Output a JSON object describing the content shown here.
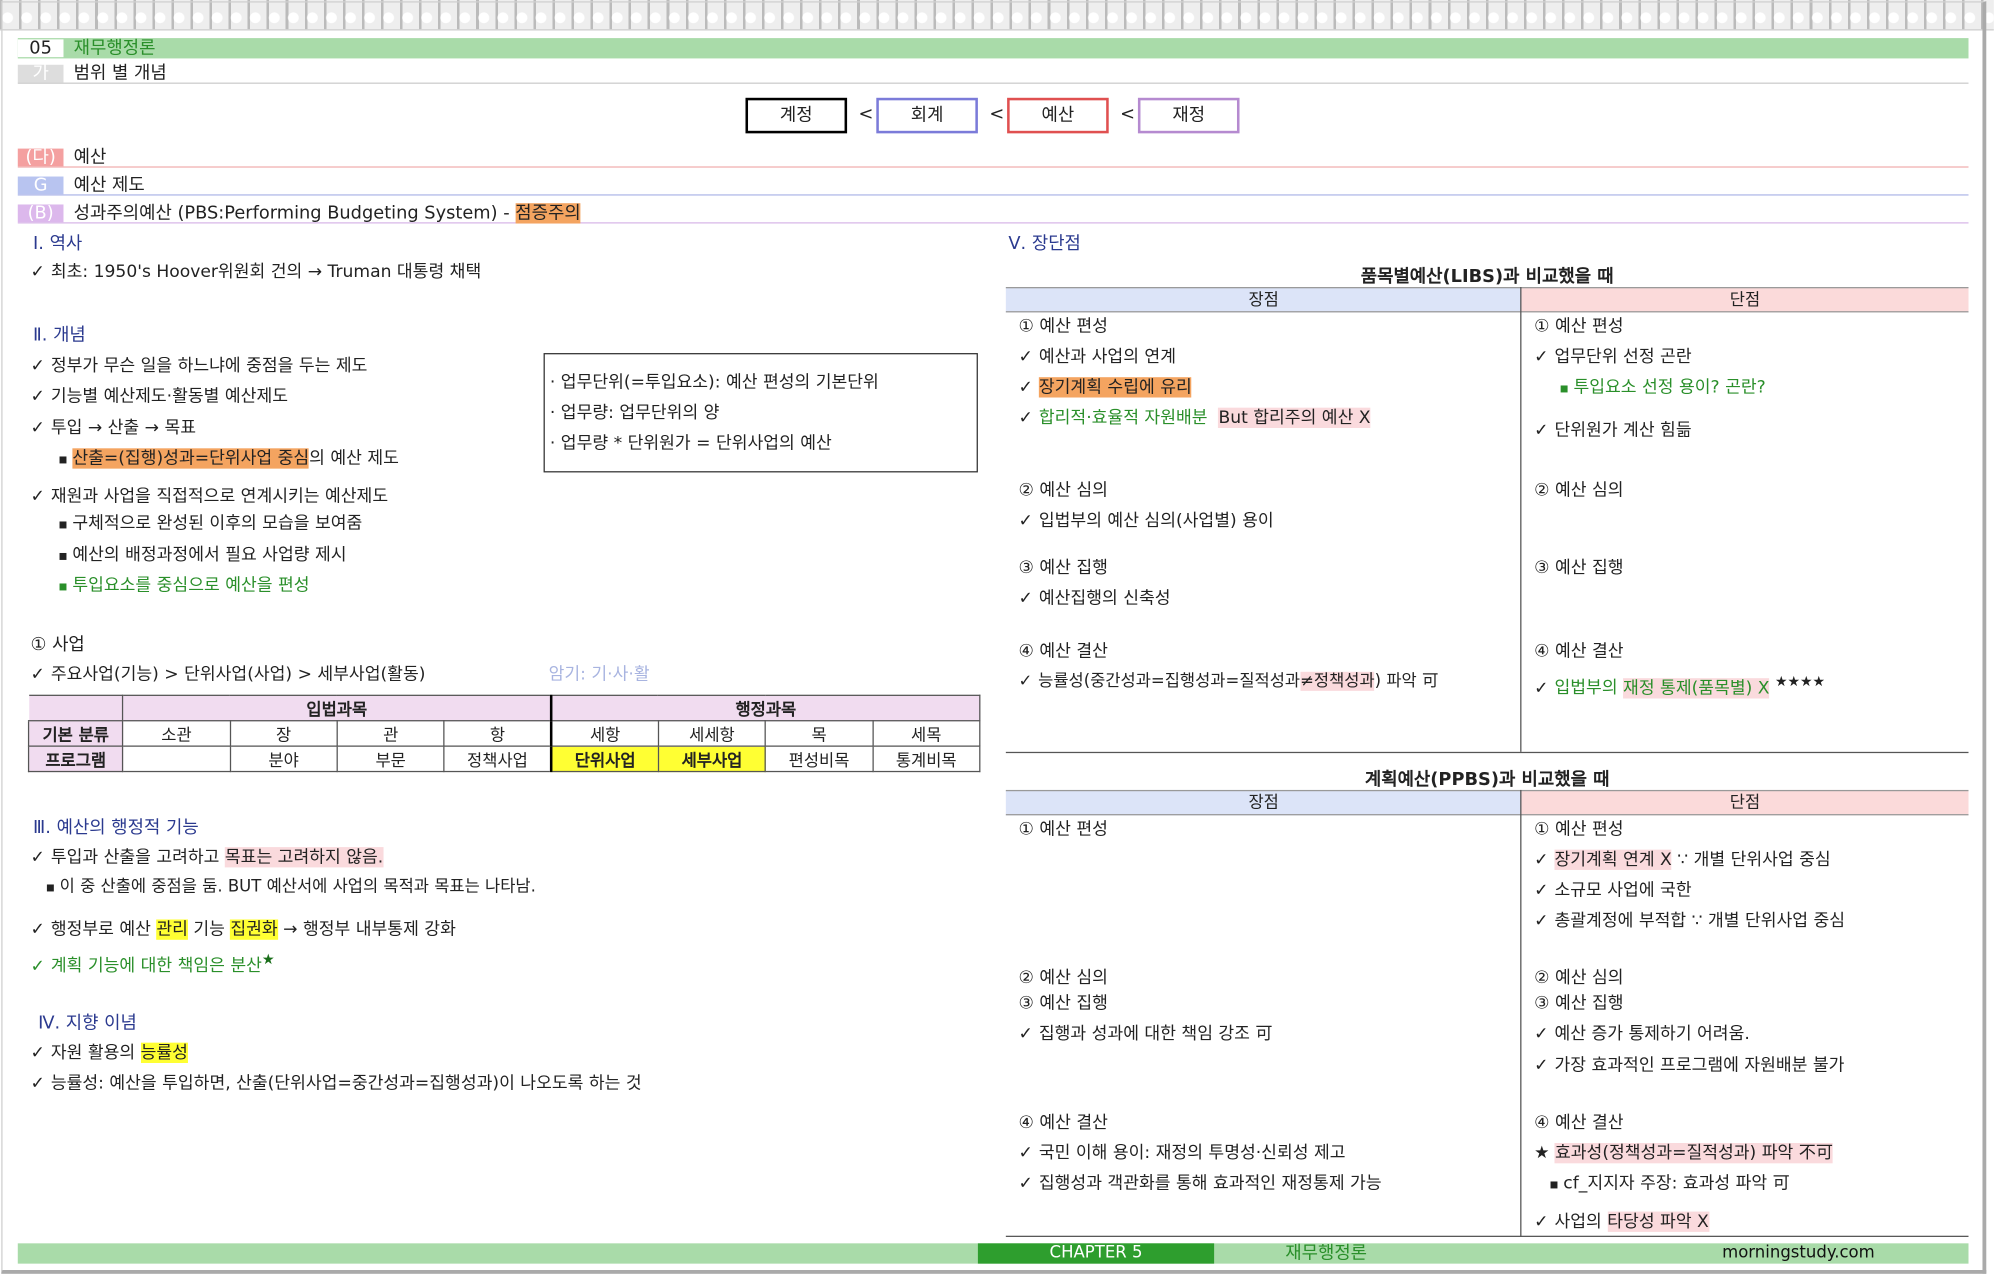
{
  "chapter": {
    "num": "05",
    "title": "재무행정론"
  },
  "sub": {
    "num": "가",
    "title": "범위 별 개념"
  },
  "scope_boxes": [
    "계정",
    "회계",
    "예산",
    "재정"
  ],
  "scope_sep": "<",
  "section_da": {
    "num": "(다)",
    "title": "예산"
  },
  "section_g": {
    "num": "G",
    "title": "예산 제도"
  },
  "section_b": {
    "num": "(B)",
    "title": "성과주의예산 (PBS:Performing Budgeting System) - ",
    "highlight": "점증주의"
  },
  "left": {
    "history_title": "Ⅰ. 역사",
    "history_line": "최초: 1950's Hoover위원회 건의 → Truman 대통령 채택",
    "concept_title": "Ⅱ. 개념",
    "concept_lines": [
      "정부가 무슨 일을 하느냐에 중점을 두는 제도",
      "기능별 예산제도·활동별 예산제도",
      "투입 → 산출 → 목표"
    ],
    "concept_bullet_hl": "산출=(집행)성과=단위사업 중심",
    "concept_bullet_rest": "의 예산 제도",
    "concept_line4": "재원과 사업을 직접적으로 연계시키는 예산제도",
    "concept_bullets": [
      "구체적으로 완성된 이후의 모습을 보여줌",
      "예산의 배정과정에서 필요 사업량 제시"
    ],
    "concept_bullet_green": "투입요소를 중심으로 예산을 편성",
    "box_lines": [
      "· 업무단위(=투입요소): 예산 편성의 기본단위",
      "· 업무량: 업무단위의 양",
      "· 업무량 * 단위원가 = 단위사업의 예산"
    ],
    "business_title": "① 사업",
    "business_line": "주요사업(기능) > 단위사업(사업) > 세부사업(활동)",
    "business_memo": "암기: 기·사·활",
    "table": {
      "group1": "입법과목",
      "group2": "행정과목",
      "row1_label": "기본 분류",
      "row1": [
        "소관",
        "장",
        "관",
        "항",
        "세항",
        "세세항",
        "목",
        "세목"
      ],
      "row2_label": "프로그램",
      "row2": [
        "",
        "분야",
        "부문",
        "정책사업",
        "단위사업",
        "세부사업",
        "편성비목",
        "통계비목"
      ]
    },
    "admin_title": "Ⅲ. 예산의 행정적 기능",
    "admin_line1a": "투입과 산출을 고려하고 ",
    "admin_line1hl": "목표는 고려하지 않음.",
    "admin_bullet": "이 중 산출에 중점을 둠. BUT 예산서에 사업의 목적과 목표는 나타남.",
    "admin_line2a": "행정부로 예산 ",
    "admin_line2hl1": "관리",
    "admin_line2b": " 기능 ",
    "admin_line2hl2": "집권화",
    "admin_line2c": " → 행정부 내부통제 강화",
    "admin_line3": "계획 기능에 대한 책임은 분산",
    "star": "★",
    "ideal_title": "Ⅳ. 지향 이념",
    "ideal_line1a": "자원 활용의 ",
    "ideal_line1hl": "능률성",
    "ideal_line2": "능률성: 예산을 투입하면, 산출(단위사업=중간성과=집행성과)이 나오도록 하는 것"
  },
  "right": {
    "title": "Ⅴ. 장단점",
    "compare1_title": "품목별예산(LIBS)과 비교했을 때",
    "compare2_title": "계획예산(PPBS)과 비교했을 때",
    "pro": "장점",
    "con": "단점",
    "c1_pro": {
      "h1": "① 예산 편성",
      "l1": "예산과 사업의 연계",
      "l2": "장기계획 수립에 유리",
      "l3a": "합리적·효율적 자원배분",
      "l3b": "But 합리주의 예산 X",
      "h2": "② 예산 심의",
      "l4": "입법부의 예산 심의(사업별) 용이",
      "h3": "③ 예산 집행",
      "l5": "예산집행의 신축성",
      "h4": "④ 예산 결산",
      "l6a": "능률성(중간성과=집행성과=질적성과",
      "l6b": "≠정책성과",
      "l6c": ") 파악 可"
    },
    "c1_con": {
      "h1": "① 예산 편성",
      "l1": "업무단위 선정 곤란",
      "l2": "투입요소 선정 용이? 곤란?",
      "l3": "단위원가 계산 힘듦",
      "h2": "② 예산 심의",
      "h3": "③ 예산 집행",
      "h4": "④ 예산 결산",
      "l4a": "입법부의 ",
      "l4b": "재정 통제(품목별) X",
      "stars": "★★★★"
    },
    "c2_pro": {
      "h1": "① 예산 편성",
      "h2": "② 예산 심의",
      "h3": "③ 예산 집행",
      "l1": "집행과 성과에 대한 책임 강조 可",
      "h4": "④ 예산 결산",
      "l2": "국민 이해 용이: 재정의 투명성·신뢰성 제고",
      "l3": "집행성과 객관화를 통해 효과적인 재정통제 가능"
    },
    "c2_con": {
      "h1": "① 예산 편성",
      "l1a": "장기계획 연계 X",
      "l1b": " ∵ 개별 단위사업 중심",
      "l2": "소규모 사업에 국한",
      "l3": "총괄계정에 부적합 ∵ 개별 단위사업 중심",
      "h2": "② 예산 심의",
      "h3": "③ 예산 집행",
      "l4": "예산 증가 통제하기 어려움.",
      "l5": "가장 효과적인 프로그램에 자원배분 불가",
      "h4": "④ 예산 결산",
      "l6": "효과성(정책성과=질적성과) 파악 不可",
      "l7": "cf_지지자 주장: 효과성 파악 可",
      "l8a": "사업의 ",
      "l8b": "타당성 파악 X"
    }
  },
  "footer": {
    "chapter": "CHAPTER 5",
    "title": "재무행정론",
    "site": "morningstudy.com"
  }
}
